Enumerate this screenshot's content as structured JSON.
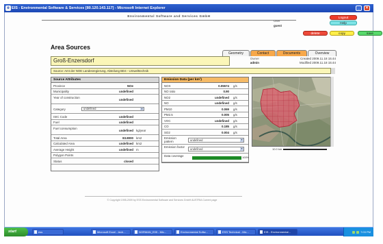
{
  "window": {
    "title": "EIS - Environmental Software & Services [80.120.143.117] - Microsoft Internet Explorer",
    "minimize": "_",
    "maximize": "□",
    "close": "×"
  },
  "banner": "Environmental Software and Services GmbH",
  "user": {
    "label": "User",
    "name": "guest"
  },
  "buttons": {
    "logout": "Logout",
    "help": "Help",
    "delete": "delete",
    "copy": "copy",
    "save": "save"
  },
  "page_title": "Area Sources",
  "tabs": [
    "Geometry",
    "Contact",
    "Documents",
    "Overview"
  ],
  "record": {
    "name": "Groß-Enzersdorf",
    "owner_label": "Owner",
    "owner": "admin",
    "created": "Created 2009.11.18 15:44",
    "modified": "Modified 2009.11.18 15:44",
    "source": "Source: Amt der NOE Landesregierung, Abteilung BD4 - Umwelttechnik"
  },
  "attributes": {
    "header": "Source Attributes",
    "rows": [
      {
        "label": "Province",
        "value": "NOe",
        "unit": ""
      },
      {
        "label": "Municipality",
        "value": "undefined",
        "unit": ""
      },
      {
        "label": "Year of construction",
        "value": "undefined",
        "unit": ""
      },
      {
        "label": "Category",
        "value": "",
        "unit": "",
        "select": "undefined"
      },
      {
        "label": "ISIC Code",
        "value": "undefined",
        "unit": ""
      },
      {
        "label": "Fuel",
        "value": "undefined",
        "unit": ""
      },
      {
        "label": "Fuel consumption",
        "value": "undefined",
        "unit": "kg/year"
      },
      {
        "label": "Total Area",
        "value": "83.8000",
        "unit": "km2"
      },
      {
        "label": "Calculated Area",
        "value": "undefined",
        "unit": "km2"
      },
      {
        "label": "Average Height",
        "value": "undefined",
        "unit": "m"
      },
      {
        "label": "Polygon Points",
        "value": "",
        "unit": ""
      },
      {
        "label": "Status",
        "value": "closed",
        "unit": ""
      }
    ]
  },
  "emissions": {
    "header": "Emission Data (per km²)",
    "rows": [
      {
        "label": "NOX",
        "value": "0.05574",
        "unit": "g/s"
      },
      {
        "label": "NO ratio",
        "value": "0.90",
        "unit": ""
      },
      {
        "label": "NO2",
        "value": "undefined",
        "unit": "g/s"
      },
      {
        "label": "NO",
        "value": "undefined",
        "unit": "g/s"
      },
      {
        "label": "PM10",
        "value": "0.069",
        "unit": "g/s"
      },
      {
        "label": "PM2.5",
        "value": "0.005",
        "unit": "g/s"
      },
      {
        "label": "VOC",
        "value": "undefined",
        "unit": "g/s"
      },
      {
        "label": "CO",
        "value": "0.185",
        "unit": "g/s"
      },
      {
        "label": "SO2",
        "value": "0.004",
        "unit": "g/s"
      }
    ],
    "pattern": {
      "label": "Emission pattern",
      "select": "undefined"
    },
    "factor": {
      "label": "Emission factor",
      "select": "undefined"
    },
    "coverage": {
      "label": "Data coverage",
      "percent": 100,
      "text": "100%"
    }
  },
  "map": {
    "scale": "10.0 km"
  },
  "footer": "© Copyright 1995-2009 by   ESS   Environmental Software and Services GmbH AUSTRIA   Current page",
  "taskbar": {
    "start": "start",
    "tasks": [
      "ess",
      "Microsoft Excel - tech...",
      "NORMAN_E05 - Mic...",
      "Environmental Softw...",
      "ESS Technical - Mic...",
      "EIS - Environmental..."
    ],
    "clock": "7:03 PM"
  }
}
